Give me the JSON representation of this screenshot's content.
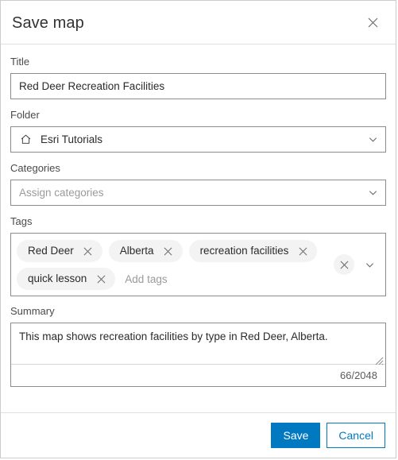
{
  "dialog": {
    "title": "Save map",
    "close_icon": "close-icon"
  },
  "form": {
    "title_field": {
      "label": "Title",
      "value": "Red Deer Recreation Facilities"
    },
    "folder_field": {
      "label": "Folder",
      "value": "Esri Tutorials",
      "icon": "home-icon",
      "chevron_icon": "chevron-down-icon"
    },
    "categories_field": {
      "label": "Categories",
      "value": "",
      "placeholder": "Assign categories",
      "chevron_icon": "chevron-down-icon"
    },
    "tags_field": {
      "label": "Tags",
      "tags": [
        {
          "label": "Red Deer",
          "remove_icon": "close-icon"
        },
        {
          "label": "Alberta",
          "remove_icon": "close-icon"
        },
        {
          "label": "recreation facilities",
          "remove_icon": "close-icon"
        },
        {
          "label": "quick lesson",
          "remove_icon": "close-icon"
        }
      ],
      "input_value": "",
      "placeholder": "Add tags",
      "clear_all_icon": "close-icon",
      "chevron_icon": "chevron-down-icon"
    },
    "summary_field": {
      "label": "Summary",
      "value": "This map shows recreation facilities by type in Red Deer, Alberta.",
      "placeholder": "",
      "char_count": "66/2048",
      "resize_icon": "resize-grip-icon"
    }
  },
  "footer": {
    "save_label": "Save",
    "cancel_label": "Cancel"
  },
  "colors": {
    "accent": "#0079c1",
    "border": "#8c8c8c",
    "divider": "#e0e0e0",
    "chip_bg": "#f3f3f3",
    "text": "#2b2b2b",
    "placeholder": "#9a9a9a"
  }
}
